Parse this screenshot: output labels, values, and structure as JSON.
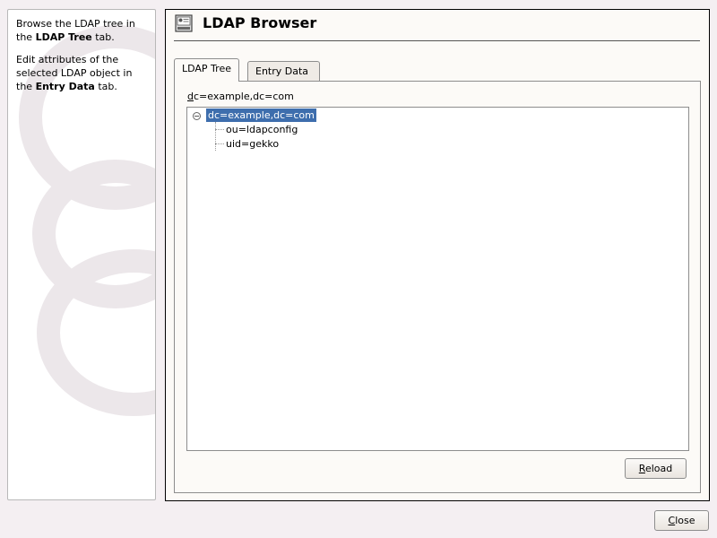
{
  "help": {
    "p1_a": "Browse the LDAP tree in the ",
    "p1_bold": "LDAP Tree",
    "p1_b": " tab.",
    "p2_a": "Edit attributes of the selected LDAP object in the ",
    "p2_bold": "Entry Data",
    "p2_b": " tab."
  },
  "header": {
    "title": "LDAP Browser",
    "icon": "ldap-browser-icon"
  },
  "tabs": [
    {
      "label": "LDAP Tree",
      "active": true
    },
    {
      "label": "Entry Data",
      "active": false
    }
  ],
  "dn": {
    "mnemonic": "d",
    "rest": "c=example,dc=com"
  },
  "tree": {
    "root": "dc=example,dc=com",
    "children": [
      "ou=ldapconfig",
      "uid=gekko"
    ]
  },
  "buttons": {
    "reload_mnemonic": "R",
    "reload_rest": "eload",
    "close_mnemonic": "C",
    "close_rest": "lose"
  },
  "colors": {
    "selection": "#3e6ead",
    "background": "#f4eff2",
    "panel": "#fcfaf7"
  }
}
